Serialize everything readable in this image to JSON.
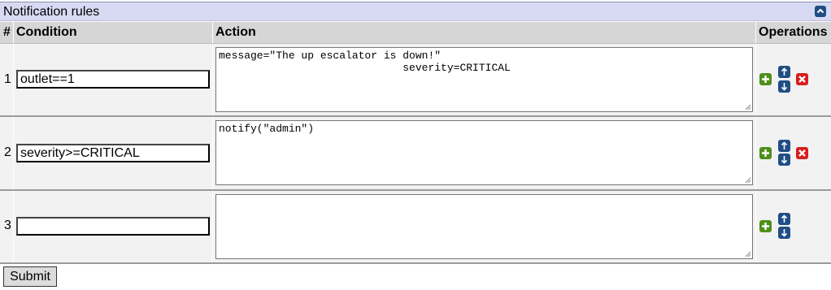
{
  "panel": {
    "title": "Notification rules",
    "collapse_icon": "chevron-up-icon"
  },
  "table": {
    "headers": {
      "num": "#",
      "condition": "Condition",
      "action": "Action",
      "operations": "Operations"
    },
    "rows": [
      {
        "num": "1",
        "condition": "outlet==1",
        "action": "message=\"The up escalator is down!\"\n                             severity=CRITICAL",
        "has_delete": true
      },
      {
        "num": "2",
        "condition": "severity>=CRITICAL",
        "action": "notify(\"admin\")",
        "has_delete": true
      },
      {
        "num": "3",
        "condition": "",
        "action": "",
        "has_delete": false
      }
    ]
  },
  "icons": {
    "add": "plus-icon",
    "up": "arrow-up-icon",
    "down": "arrow-down-icon",
    "delete": "close-icon"
  },
  "colors": {
    "title_bg": "#d8daf4",
    "add": "#4d8f1a",
    "move": "#1f4e85",
    "delete": "#d91c1c"
  },
  "submit_label": "Submit"
}
